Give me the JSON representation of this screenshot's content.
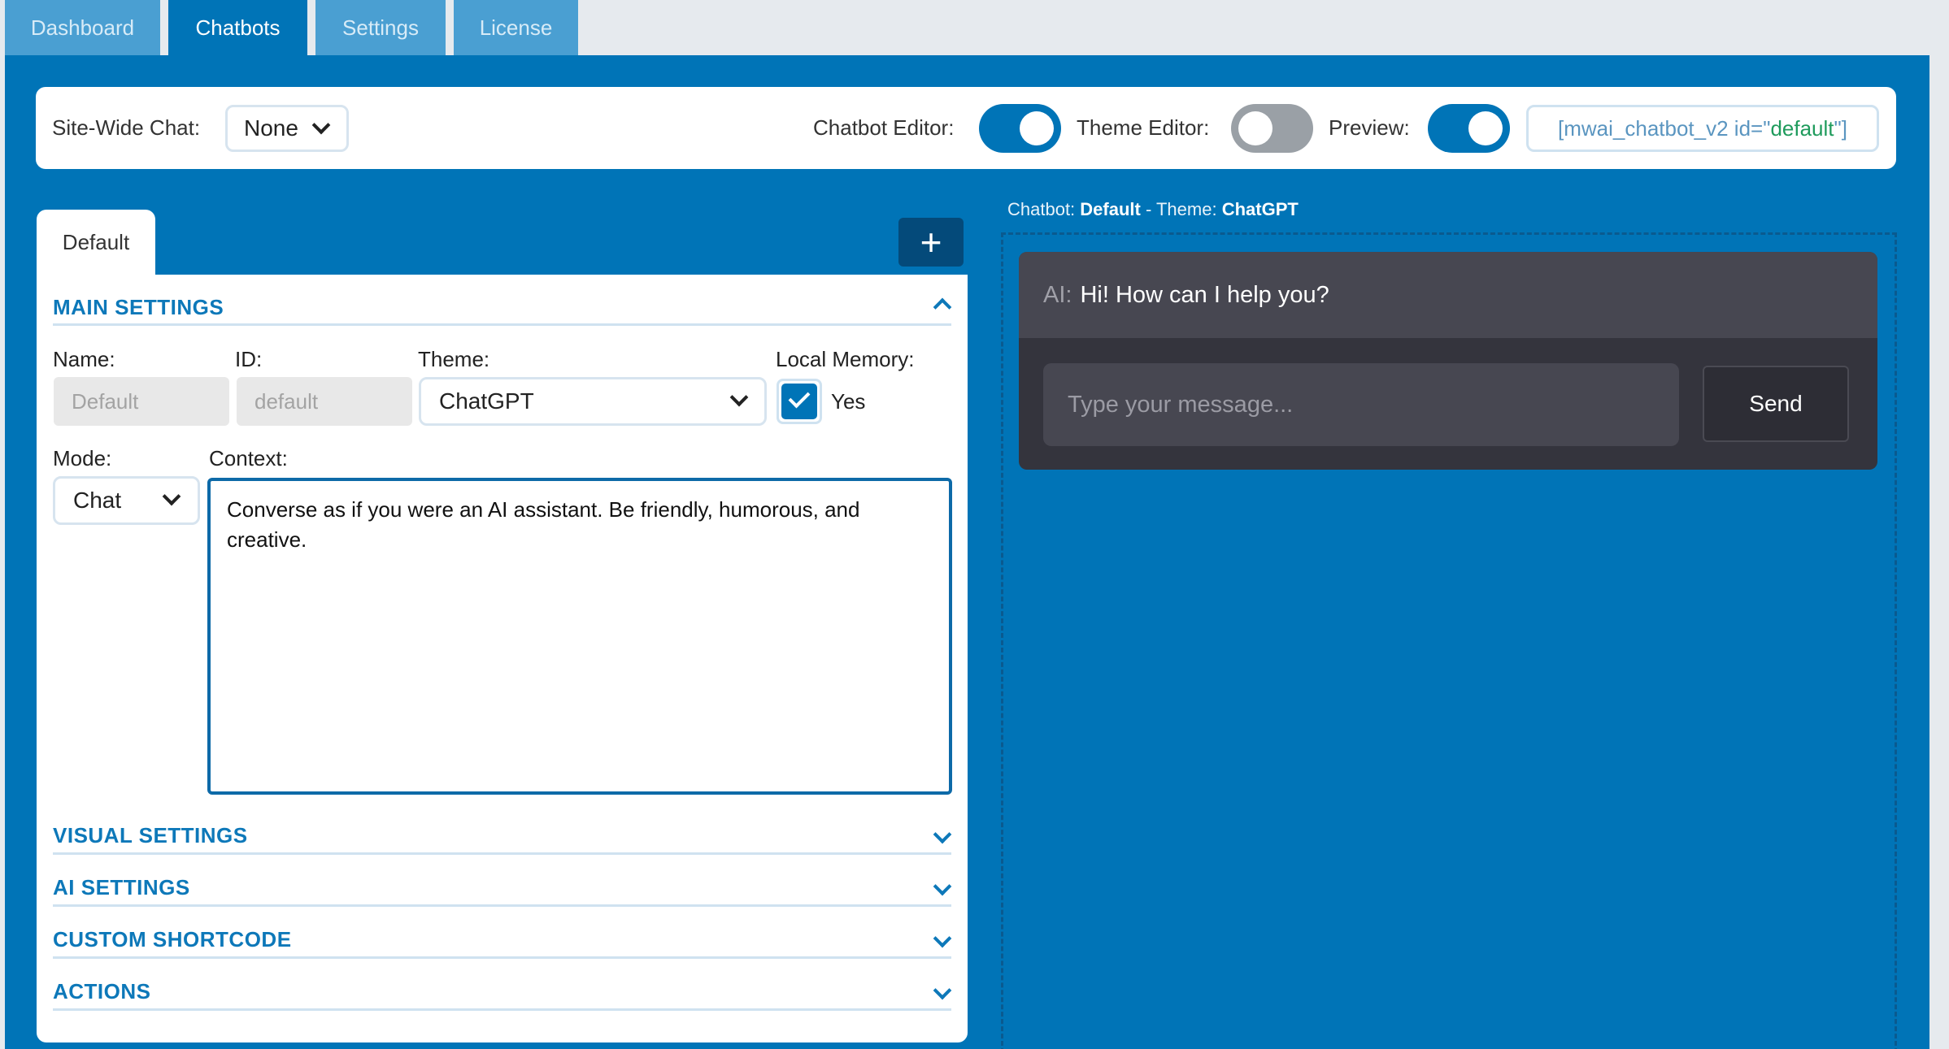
{
  "tabs": [
    {
      "label": "Dashboard",
      "active": false
    },
    {
      "label": "Chatbots",
      "active": true
    },
    {
      "label": "Settings",
      "active": false
    },
    {
      "label": "License",
      "active": false
    }
  ],
  "header": {
    "site_wide_chat_label": "Site-Wide Chat:",
    "site_wide_chat_value": "None",
    "chatbot_editor_label": "Chatbot Editor:",
    "chatbot_editor_on": true,
    "theme_editor_label": "Theme Editor:",
    "theme_editor_on": false,
    "preview_label": "Preview:",
    "preview_on": true,
    "shortcode_prefix": "[mwai_chatbot_v2 id=\"",
    "shortcode_id": "default",
    "shortcode_suffix": "\"]"
  },
  "editor": {
    "tab_label": "Default",
    "add_button": "+",
    "main_settings_title": "MAIN SETTINGS",
    "name_label": "Name:",
    "name_placeholder": "Default",
    "id_label": "ID:",
    "id_placeholder": "default",
    "theme_label": "Theme:",
    "theme_value": "ChatGPT",
    "local_memory_label": "Local Memory:",
    "local_memory_checked": true,
    "local_memory_text": "Yes",
    "mode_label": "Mode:",
    "mode_value": "Chat",
    "context_label": "Context:",
    "context_value": "Converse as if you were an AI assistant. Be friendly, humorous, and creative.",
    "sections": [
      {
        "title": "VISUAL SETTINGS"
      },
      {
        "title": "AI SETTINGS"
      },
      {
        "title": "CUSTOM SHORTCODE"
      },
      {
        "title": "ACTIONS"
      }
    ]
  },
  "preview": {
    "caption_prefix_chatbot": "Chatbot: ",
    "chatbot_name": "Default",
    "caption_sep_theme": " - Theme: ",
    "theme_name": "ChatGPT",
    "ai_label": "AI:",
    "ai_message": "Hi! How can I help you?",
    "input_placeholder": "Type your message...",
    "send_label": "Send"
  },
  "colors": {
    "primary": "#0074b7",
    "dark_button": "#044a7a",
    "chat_bg": "#34343d"
  },
  "icons": [
    "chevron-down-icon",
    "chevron-up-icon",
    "plus-icon",
    "check-icon"
  ]
}
